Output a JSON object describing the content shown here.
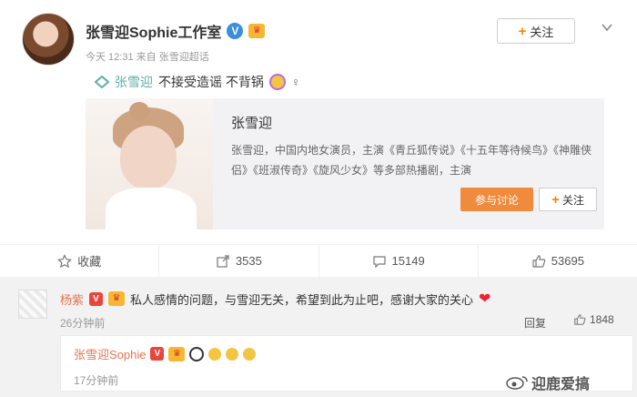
{
  "post": {
    "author": "张雪迎Sophie工作室",
    "follow_label": "关注",
    "meta": "今天 12:31 来自 张雪迎超话",
    "topic": "张雪迎",
    "text": "不接受造谣 不背锅",
    "female_symbol": "♀"
  },
  "card": {
    "title": "张雪迎",
    "description": "张雪迎，中国内地女演员，主演《青丘狐传说》《十五年等待候鸟》《神雕侠侣》《班淑传奇》《旋风少女》等多部热播剧，主演",
    "join_label": "参与讨论",
    "follow_label": "关注"
  },
  "actions": [
    {
      "label": "收藏",
      "icon": "star-icon"
    },
    {
      "label": "3535",
      "icon": "share-icon"
    },
    {
      "label": "15149",
      "icon": "comment-icon"
    },
    {
      "label": "53695",
      "icon": "like-icon"
    }
  ],
  "comment": {
    "user": "杨紫",
    "text": "私人感情的问题，与雪迎无关，希望到此为止吧，感谢大家的关心",
    "time": "26分钟前",
    "reply_label": "回复",
    "likes": "1848",
    "sub": {
      "user": "张雪迎Sophie",
      "time": "17分钟前"
    }
  },
  "watermark": "迎鹿爱搞"
}
